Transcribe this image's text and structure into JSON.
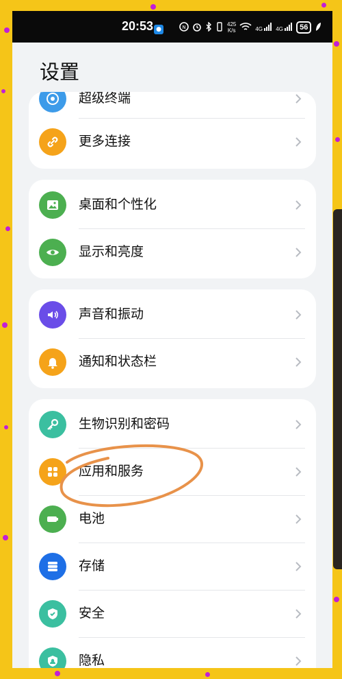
{
  "status_bar": {
    "time": "20:53",
    "app_badge": "▪",
    "speed_top": "425",
    "speed_bottom": "K/s",
    "signal1": "4G",
    "signal2": "4G",
    "battery": "56"
  },
  "page": {
    "title": "设置"
  },
  "groups": [
    {
      "items": [
        {
          "label": "超级终端",
          "icon": "radar-icon",
          "color": "#3d9be9"
        },
        {
          "label": "更多连接",
          "icon": "link-icon",
          "color": "#f5a31a"
        }
      ]
    },
    {
      "items": [
        {
          "label": "桌面和个性化",
          "icon": "wallpaper-icon",
          "color": "#4caf50"
        },
        {
          "label": "显示和亮度",
          "icon": "eye-icon",
          "color": "#4caf50"
        }
      ]
    },
    {
      "items": [
        {
          "label": "声音和振动",
          "icon": "speaker-icon",
          "color": "#6a4de8"
        },
        {
          "label": "通知和状态栏",
          "icon": "bell-icon",
          "color": "#f5a31a"
        }
      ]
    },
    {
      "items": [
        {
          "label": "生物识别和密码",
          "icon": "key-icon",
          "color": "#3bbfa0"
        },
        {
          "label": "应用和服务",
          "icon": "apps-icon",
          "color": "#f5a31a"
        },
        {
          "label": "电池",
          "icon": "battery-icon",
          "color": "#4caf50"
        },
        {
          "label": "存储",
          "icon": "storage-icon",
          "color": "#1e6fe6"
        },
        {
          "label": "安全",
          "icon": "shield-icon",
          "color": "#3bbfa0"
        },
        {
          "label": "隐私",
          "icon": "privacy-icon",
          "color": "#3bbfa0"
        }
      ]
    }
  ],
  "annotation_color": "#e8924a"
}
